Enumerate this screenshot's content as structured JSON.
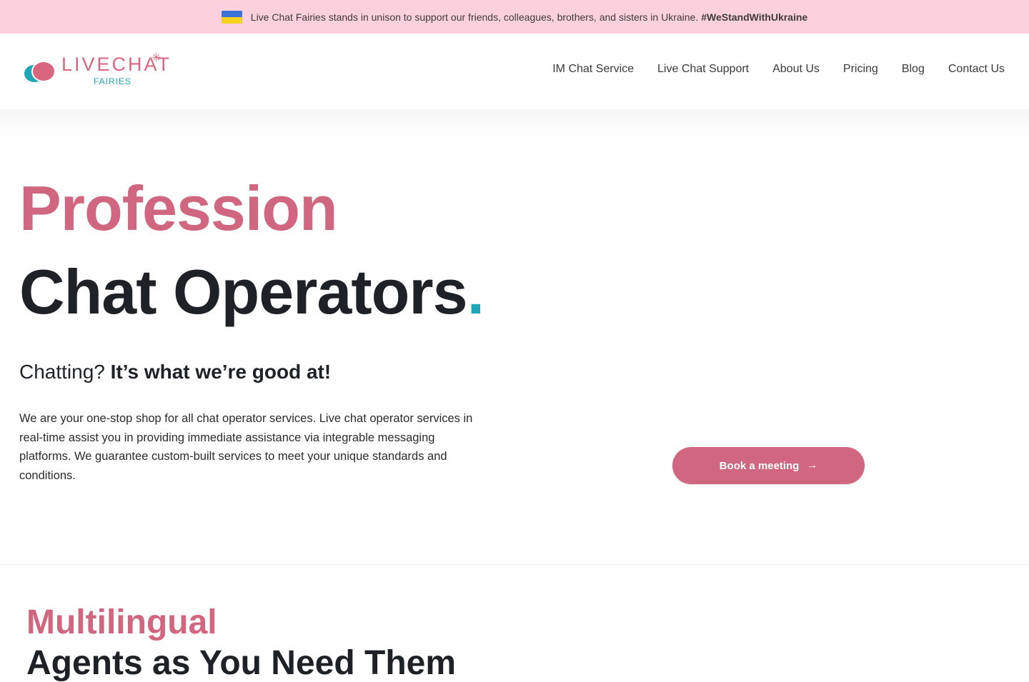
{
  "banner": {
    "flag_icon": "ukraine-flag",
    "text": "Live Chat Fairies stands in unison to support our friends, colleagues, brothers, and sisters in Ukraine.",
    "hashtag": "#WeStandWithUkraine"
  },
  "logo": {
    "wordmark": "LIVECHAT",
    "sub": "FAIRIES"
  },
  "nav": {
    "items": [
      {
        "label": "IM Chat Service"
      },
      {
        "label": "Live Chat Support"
      },
      {
        "label": "About Us"
      },
      {
        "label": "Pricing"
      },
      {
        "label": "Blog"
      },
      {
        "label": "Contact Us"
      }
    ]
  },
  "hero": {
    "title_line1": "Profession",
    "title_line2": "Chat Operators",
    "title_dot": ".",
    "tagline_regular": "Chatting?",
    "tagline_bold": "It’s what we’re good at!",
    "intro": "We are your one-stop shop for all chat operator services. Live chat operator services in real-time assist you in providing immediate assistance via integrable messaging platforms. We guarantee custom-built services to meet your unique standards and conditions.",
    "cta_label": "Book a meeting",
    "cta_icon": "arrow-right-icon"
  },
  "section2": {
    "title": "Multilingual",
    "subtitle": "Agents as You Need Them"
  },
  "colors": {
    "accent_pink": "#d0667f",
    "accent_teal": "#1ea6b8",
    "banner_bg": "#fcd0dc"
  }
}
